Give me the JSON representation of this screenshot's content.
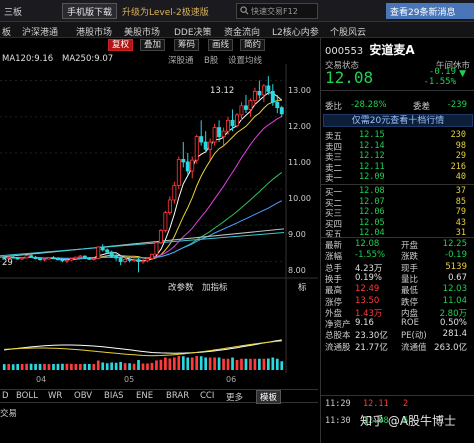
{
  "topbar": {
    "menu_left": "三板",
    "download_btn": "手机版下载",
    "upgrade": "升级为Level-2极速版",
    "search_placeholder": "快速交易F12",
    "message_btn": "查看29条新消息"
  },
  "nav": {
    "items": [
      "板",
      "沪深港通",
      "港股市场",
      "美股市场",
      "DDE决策",
      "资金流向",
      "L2核心内参",
      "个股风云"
    ]
  },
  "toolbar": {
    "active_label": "复权",
    "add_label": "叠加",
    "stats_label": "筹码",
    "draw_label": "画线",
    "brief_label": "简约",
    "source_label": "深股通",
    "b_label": "B股",
    "settings_label": "设置均线"
  },
  "ma": {
    "ma120": "MA120:9.16",
    "ma250": "MA250:9.07"
  },
  "price_axis": [
    "13.00",
    "12.00",
    "11.00",
    "10.00",
    "9.00",
    "8.00"
  ],
  "chart_annotations": {
    "high": "13.12",
    "low": "29"
  },
  "indicator_btns": {
    "change": "改参数",
    "add": "加指标",
    "cap": "标"
  },
  "date_axis": [
    "04",
    "05",
    "06"
  ],
  "tabs": [
    "D",
    "BOLL",
    "WR",
    "OBV",
    "BIAS",
    "ENE",
    "BRAR",
    "CCI",
    "更多",
    "模板"
  ],
  "bottom_tab": "交易",
  "chart_data": {
    "type": "candlestick",
    "title": "",
    "price_range": [
      7.6,
      13.4
    ],
    "candles": [
      [
        8.12,
        8.15,
        8.08,
        8.1
      ],
      [
        8.1,
        8.14,
        8.06,
        8.12
      ],
      [
        8.12,
        8.16,
        8.1,
        8.11
      ],
      [
        8.11,
        8.13,
        8.05,
        8.07
      ],
      [
        8.07,
        8.12,
        8.04,
        8.1
      ],
      [
        8.1,
        8.18,
        8.08,
        8.16
      ],
      [
        8.16,
        8.2,
        8.1,
        8.12
      ],
      [
        8.12,
        8.15,
        8.06,
        8.08
      ],
      [
        8.08,
        8.1,
        8.02,
        8.05
      ],
      [
        8.05,
        8.09,
        8.0,
        8.07
      ],
      [
        8.07,
        8.12,
        8.05,
        8.11
      ],
      [
        8.11,
        8.15,
        8.07,
        8.09
      ],
      [
        8.09,
        8.12,
        8.03,
        8.05
      ],
      [
        8.05,
        8.08,
        7.98,
        8.02
      ],
      [
        8.02,
        8.06,
        7.96,
        8.04
      ],
      [
        8.04,
        8.1,
        8.01,
        8.08
      ],
      [
        8.08,
        8.14,
        8.06,
        8.12
      ],
      [
        8.12,
        8.18,
        8.1,
        8.15
      ],
      [
        8.15,
        8.17,
        8.08,
        8.1
      ],
      [
        8.1,
        8.12,
        8.04,
        8.06
      ],
      [
        8.06,
        8.1,
        8.02,
        8.08
      ],
      [
        8.08,
        8.42,
        8.06,
        8.4
      ],
      [
        8.4,
        8.48,
        8.28,
        8.32
      ],
      [
        8.32,
        8.36,
        8.22,
        8.26
      ],
      [
        8.26,
        8.3,
        8.1,
        8.14
      ],
      [
        8.14,
        8.2,
        8.02,
        8.1
      ],
      [
        8.1,
        8.14,
        7.9,
        8.0
      ],
      [
        8.0,
        8.1,
        7.95,
        8.06
      ],
      [
        8.06,
        8.12,
        7.98,
        8.03
      ],
      [
        8.03,
        8.08,
        7.98,
        8.05
      ],
      [
        8.05,
        8.1,
        7.7,
        8.0
      ],
      [
        8.0,
        8.06,
        7.94,
        8.02
      ],
      [
        8.02,
        8.1,
        7.98,
        8.08
      ],
      [
        8.08,
        8.22,
        8.05,
        8.2
      ],
      [
        8.2,
        8.55,
        8.18,
        8.52
      ],
      [
        8.52,
        8.9,
        8.48,
        8.86
      ],
      [
        8.86,
        9.4,
        8.8,
        9.35
      ],
      [
        9.35,
        9.8,
        9.28,
        9.7
      ],
      [
        9.7,
        10.2,
        9.6,
        10.1
      ],
      [
        10.1,
        10.9,
        10.0,
        10.82
      ],
      [
        10.82,
        11.3,
        10.6,
        10.75
      ],
      [
        10.75,
        11.0,
        10.4,
        10.5
      ],
      [
        10.5,
        10.9,
        10.3,
        10.8
      ],
      [
        10.8,
        11.5,
        10.7,
        11.45
      ],
      [
        11.45,
        11.9,
        11.2,
        11.3
      ],
      [
        11.3,
        11.6,
        11.0,
        11.1
      ],
      [
        11.1,
        11.4,
        10.8,
        11.3
      ],
      [
        11.3,
        11.8,
        11.2,
        11.7
      ],
      [
        11.7,
        11.9,
        11.3,
        11.45
      ],
      [
        11.45,
        11.7,
        11.2,
        11.6
      ],
      [
        11.6,
        12.0,
        11.5,
        11.9
      ],
      [
        11.9,
        12.2,
        11.6,
        11.75
      ],
      [
        11.75,
        12.1,
        11.7,
        12.05
      ],
      [
        12.05,
        12.4,
        11.9,
        12.3
      ],
      [
        12.3,
        12.6,
        12.1,
        12.2
      ],
      [
        12.2,
        12.5,
        12.0,
        12.45
      ],
      [
        12.45,
        12.8,
        12.3,
        12.7
      ],
      [
        12.7,
        13.0,
        12.5,
        12.6
      ],
      [
        12.6,
        12.9,
        12.4,
        12.85
      ],
      [
        12.85,
        13.12,
        12.6,
        12.7
      ],
      [
        12.7,
        12.9,
        12.3,
        12.4
      ],
      [
        12.4,
        12.6,
        12.1,
        12.25
      ],
      [
        12.25,
        12.3,
        12.0,
        12.08
      ]
    ]
  },
  "quote": {
    "code": "000553",
    "name": "安道麦A",
    "status_label": "交易状态",
    "status_value": "午间休市",
    "price": "12.08",
    "change": "-0.19",
    "change_pct": "-1.55%",
    "ratio_label": "委比",
    "ratio_value": "-28.28%",
    "diff_label": "委差",
    "diff_value": "-239",
    "banner": "仅需20元查看十档行情",
    "asks": [
      {
        "label": "卖五",
        "price": "12.15",
        "vol": "230"
      },
      {
        "label": "卖四",
        "price": "12.14",
        "vol": "98"
      },
      {
        "label": "卖三",
        "price": "12.12",
        "vol": "29"
      },
      {
        "label": "卖二",
        "price": "12.11",
        "vol": "216"
      },
      {
        "label": "卖一",
        "price": "12.09",
        "vol": "40"
      }
    ],
    "bids": [
      {
        "label": "买一",
        "price": "12.08",
        "vol": "37"
      },
      {
        "label": "买二",
        "price": "12.07",
        "vol": "85"
      },
      {
        "label": "买三",
        "price": "12.06",
        "vol": "79"
      },
      {
        "label": "买四",
        "price": "12.05",
        "vol": "43"
      },
      {
        "label": "买五",
        "price": "12.04",
        "vol": "31"
      }
    ],
    "stats": [
      {
        "l1": "最新",
        "v1": "12.08",
        "c1": "green",
        "l2": "开盘",
        "v2": "12.25",
        "c2": "green"
      },
      {
        "l1": "涨幅",
        "v1": "-1.55%",
        "c1": "green",
        "l2": "涨跌",
        "v2": "-0.19",
        "c2": "green"
      },
      {
        "l1": "总手",
        "v1": "4.23万",
        "c1": "white",
        "l2": "现手",
        "v2": "5139",
        "c2": "yellow"
      },
      {
        "l1": "换手",
        "v1": "0.19%",
        "c1": "white",
        "l2": "量比",
        "v2": "0.67",
        "c2": "white"
      },
      {
        "l1": "最高",
        "v1": "12.49",
        "c1": "red",
        "l2": "最低",
        "v2": "12.03",
        "c2": "green"
      },
      {
        "l1": "涨停",
        "v1": "13.50",
        "c1": "red",
        "l2": "跌停",
        "v2": "11.04",
        "c2": "green"
      },
      {
        "l1": "外盘",
        "v1": "1.43万",
        "c1": "red",
        "l2": "内盘",
        "v2": "2.80万",
        "c2": "green"
      },
      {
        "l1": "净资产",
        "v1": "9.16",
        "c1": "white",
        "l2": "ROE",
        "v2": "0.50%",
        "c2": "white"
      },
      {
        "l1": "总股本",
        "v1": "23.30亿",
        "c1": "white",
        "l2": "PE(动)",
        "v2": "281.4",
        "c2": "white"
      },
      {
        "l1": "流通股",
        "v1": "21.77亿",
        "c1": "white",
        "l2": "流通值",
        "v2": "263.0亿",
        "c2": "white"
      }
    ],
    "ticks": [
      {
        "time": "11:29",
        "price": "12.11",
        "vol": "2",
        "dir": "red"
      },
      {
        "time": "11:30",
        "price": "12.08",
        "vol": "6",
        "dir": "green"
      }
    ]
  },
  "watermark": "知乎 @A股牛博士"
}
